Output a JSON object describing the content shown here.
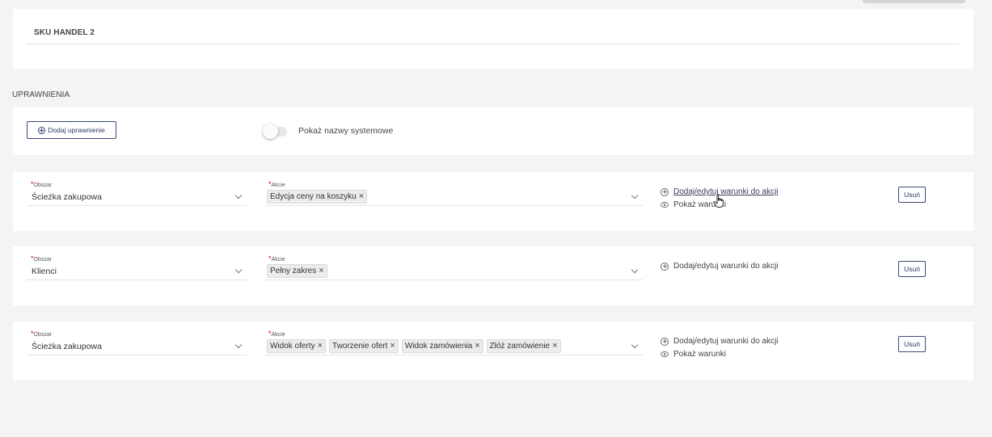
{
  "sku_section": {
    "title": "SKU HANDEL 2"
  },
  "permissions": {
    "section_title": "UPRAWNIENIA",
    "add_button_label": "Dodaj uprawnienie",
    "toggle_label": "Pokaż nazwy systemowe",
    "toggle_on": false
  },
  "rows": [
    {
      "area_label": "Obszar",
      "area_value": "Ścieżka zakupowa",
      "actions_label": "Akcje",
      "actions": [
        "Edycja ceny na koszyku"
      ],
      "edit_conditions": "Dodaj/edytuj warunki do akcji",
      "show_conditions": "Pokaż warunki",
      "remove_label": "Usuń"
    },
    {
      "area_label": "Obszar",
      "area_value": "Klienci",
      "actions_label": "Akcje",
      "actions": [
        "Pełny zakres"
      ],
      "edit_conditions": "Dodaj/edytuj warunki do akcji",
      "remove_label": "Usuń"
    },
    {
      "area_label": "Obszar",
      "area_value": "Ścieżka zakupowa",
      "actions_label": "Akcje",
      "actions": [
        "Widok oferty",
        "Tworzenie ofert",
        "Widok zamówienia",
        "Złóż zamówienie"
      ],
      "edit_conditions": "Dodaj/edytuj warunki do akcji",
      "show_conditions": "Pokaż warunki",
      "remove_label": "Usuń"
    }
  ],
  "colors": {
    "accent": "#2c3a66",
    "required": "#d0021b",
    "background": "#f4f4f4"
  }
}
